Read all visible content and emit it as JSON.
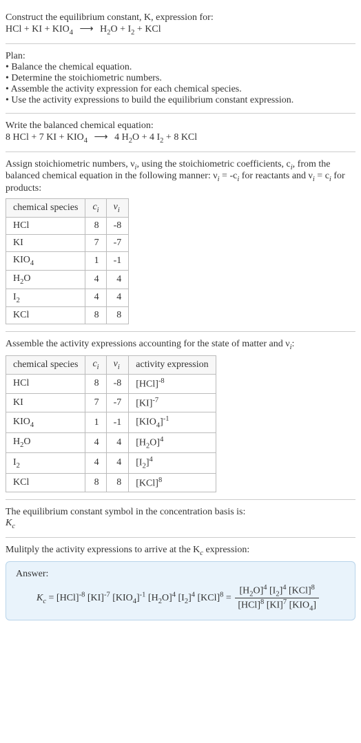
{
  "header": {
    "line1": "Construct the equilibrium constant, K, expression for:",
    "eq_lhs_a": "HCl + KI + KIO",
    "eq_lhs_b": "4",
    "arrow": "⟶",
    "eq_rhs_a": "H",
    "eq_rhs_b": "2",
    "eq_rhs_c": "O + I",
    "eq_rhs_d": "2",
    "eq_rhs_e": " + KCl"
  },
  "plan": {
    "title": "Plan:",
    "b1": "• Balance the chemical equation.",
    "b2": "• Determine the stoichiometric numbers.",
    "b3": "• Assemble the activity expression for each chemical species.",
    "b4": "• Use the activity expressions to build the equilibrium constant expression."
  },
  "balanced": {
    "title": "Write the balanced chemical equation:",
    "lhs_a": "8 HCl + 7 KI + KIO",
    "lhs_b": "4",
    "arrow": "⟶",
    "rhs_a": "4 H",
    "rhs_b": "2",
    "rhs_c": "O + 4 I",
    "rhs_d": "2",
    "rhs_e": " + 8 KCl"
  },
  "assign": {
    "text_a": "Assign stoichiometric numbers, ν",
    "text_b": "i",
    "text_c": ", using the stoichiometric coefficients, c",
    "text_d": "i",
    "text_e": ", from the balanced chemical equation in the following manner: ν",
    "text_f": "i",
    "text_g": " = -c",
    "text_h": "i",
    "text_i": " for reactants and ν",
    "text_j": "i",
    "text_k": " = c",
    "text_l": "i",
    "text_m": " for products:"
  },
  "table1": {
    "h1": "chemical species",
    "h2_a": "c",
    "h2_b": "i",
    "h3_a": "ν",
    "h3_b": "i",
    "r1": {
      "sp": "HCl",
      "c": "8",
      "v": "-8"
    },
    "r2": {
      "sp": "KI",
      "c": "7",
      "v": "-7"
    },
    "r3": {
      "sp_a": "KIO",
      "sp_b": "4",
      "c": "1",
      "v": "-1"
    },
    "r4": {
      "sp_a": "H",
      "sp_b": "2",
      "sp_c": "O",
      "c": "4",
      "v": "4"
    },
    "r5": {
      "sp_a": "I",
      "sp_b": "2",
      "c": "4",
      "v": "4"
    },
    "r6": {
      "sp": "KCl",
      "c": "8",
      "v": "8"
    }
  },
  "assemble": {
    "text_a": "Assemble the activity expressions accounting for the state of matter and ν",
    "text_b": "i",
    "text_c": ":"
  },
  "table2": {
    "h1": "chemical species",
    "h2_a": "c",
    "h2_b": "i",
    "h3_a": "ν",
    "h3_b": "i",
    "h4": "activity expression",
    "r1": {
      "sp": "HCl",
      "c": "8",
      "v": "-8",
      "ae_a": "[HCl]",
      "ae_b": "-8"
    },
    "r2": {
      "sp": "KI",
      "c": "7",
      "v": "-7",
      "ae_a": "[KI]",
      "ae_b": "-7"
    },
    "r3": {
      "sp_a": "KIO",
      "sp_b": "4",
      "c": "1",
      "v": "-1",
      "ae_a": "[KIO",
      "ae_b": "4",
      "ae_c": "]",
      "ae_d": "-1"
    },
    "r4": {
      "sp_a": "H",
      "sp_b": "2",
      "sp_c": "O",
      "c": "4",
      "v": "4",
      "ae_a": "[H",
      "ae_b": "2",
      "ae_c": "O]",
      "ae_d": "4"
    },
    "r5": {
      "sp_a": "I",
      "sp_b": "2",
      "c": "4",
      "v": "4",
      "ae_a": "[I",
      "ae_b": "2",
      "ae_c": "]",
      "ae_d": "4"
    },
    "r6": {
      "sp": "KCl",
      "c": "8",
      "v": "8",
      "ae_a": "[KCl]",
      "ae_b": "8"
    }
  },
  "symbol": {
    "line1": "The equilibrium constant symbol in the concentration basis is:",
    "k": "K",
    "c": "c"
  },
  "multiply": {
    "text_a": "Mulitply the activity expressions to arrive at the K",
    "text_b": "c",
    "text_c": " expression:"
  },
  "answer": {
    "label": "Answer:",
    "k": "K",
    "c": "c",
    "eq": " = ",
    "p1": "[HCl]",
    "e1": "-8",
    "p2": " [KI]",
    "e2": "-7",
    "p3": " [KIO",
    "p3s": "4",
    "p3e": "]",
    "e3": "-1",
    "p4": " [H",
    "p4s": "2",
    "p4e": "O]",
    "e4": "4",
    "p5": " [I",
    "p5s": "2",
    "p5e": "]",
    "e5": "4",
    "p6": " [KCl]",
    "e6": "8",
    "eq2": " = ",
    "num1": "[H",
    "num1s": "2",
    "num1e": "O]",
    "numE1": "4",
    "num2": " [I",
    "num2s": "2",
    "num2e": "]",
    "numE2": "4",
    "num3": " [KCl]",
    "numE3": "8",
    "den1": "[HCl]",
    "denE1": "8",
    "den2": " [KI]",
    "denE2": "7",
    "den3": " [KIO",
    "den3s": "4",
    "den3e": "]"
  }
}
